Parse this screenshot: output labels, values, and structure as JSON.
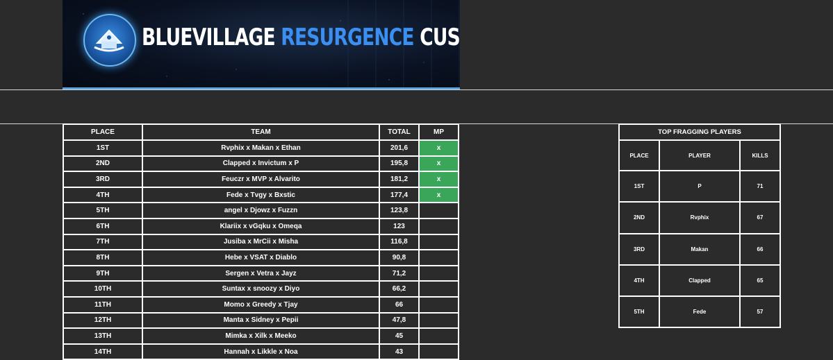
{
  "banner": {
    "title_part1": "BLUEVILLAGE",
    "title_part2": "RESURGENCE",
    "title_part3": "CUSTOMS",
    "logo_icon": "bluevillage-logo-icon"
  },
  "standings": {
    "headers": {
      "place": "PLACE",
      "team": "TEAM",
      "total": "TOTAL",
      "mp": "MP"
    },
    "rows": [
      {
        "place": "1ST",
        "team": "Rvphix x Makan x Ethan",
        "total": "201,6",
        "mp": "x"
      },
      {
        "place": "2ND",
        "team": "Clapped x Invictum x P",
        "total": "195,8",
        "mp": "x"
      },
      {
        "place": "3RD",
        "team": "Feuczr x MVP x Alvarito",
        "total": "181,2",
        "mp": "x"
      },
      {
        "place": "4TH",
        "team": "Fede x Tvgy x Bxstic",
        "total": "177,4",
        "mp": "x"
      },
      {
        "place": "5TH",
        "team": "angel x Djowz x Fuzzn",
        "total": "123,8",
        "mp": ""
      },
      {
        "place": "6TH",
        "team": "Klariix x vGqku x Omeqa",
        "total": "123",
        "mp": ""
      },
      {
        "place": "7TH",
        "team": "Jusiba x MrCii x Misha",
        "total": "116,8",
        "mp": ""
      },
      {
        "place": "8TH",
        "team": "Hebe x VSAT x Diablo",
        "total": "90,8",
        "mp": ""
      },
      {
        "place": "9TH",
        "team": "Sergen x Vetra x Jayz",
        "total": "71,2",
        "mp": ""
      },
      {
        "place": "10TH",
        "team": "Suntax x snoozy x Diyo",
        "total": "66,2",
        "mp": ""
      },
      {
        "place": "11TH",
        "team": "Momo x Greedy x Tjay",
        "total": "66",
        "mp": ""
      },
      {
        "place": "12TH",
        "team": "Manta x Sidney x Pepii",
        "total": "47,8",
        "mp": ""
      },
      {
        "place": "13TH",
        "team": "Mimka x Xilk x Meeko",
        "total": "45",
        "mp": ""
      },
      {
        "place": "14TH",
        "team": "Hannah x Likkle x Noa",
        "total": "43",
        "mp": ""
      }
    ],
    "mp_color": "#3aa65a"
  },
  "top_fraggers": {
    "title": "TOP FRAGGING PLAYERS",
    "headers": {
      "place": "PLACE",
      "player": "PLAYER",
      "kills": "KILLS"
    },
    "rows": [
      {
        "place": "1ST",
        "player": "P",
        "kills": "71"
      },
      {
        "place": "2ND",
        "player": "Rvphix",
        "kills": "67"
      },
      {
        "place": "3RD",
        "player": "Makan",
        "kills": "66"
      },
      {
        "place": "4TH",
        "player": "Clapped",
        "kills": "65"
      },
      {
        "place": "5TH",
        "player": "Fede",
        "kills": "57"
      }
    ]
  }
}
